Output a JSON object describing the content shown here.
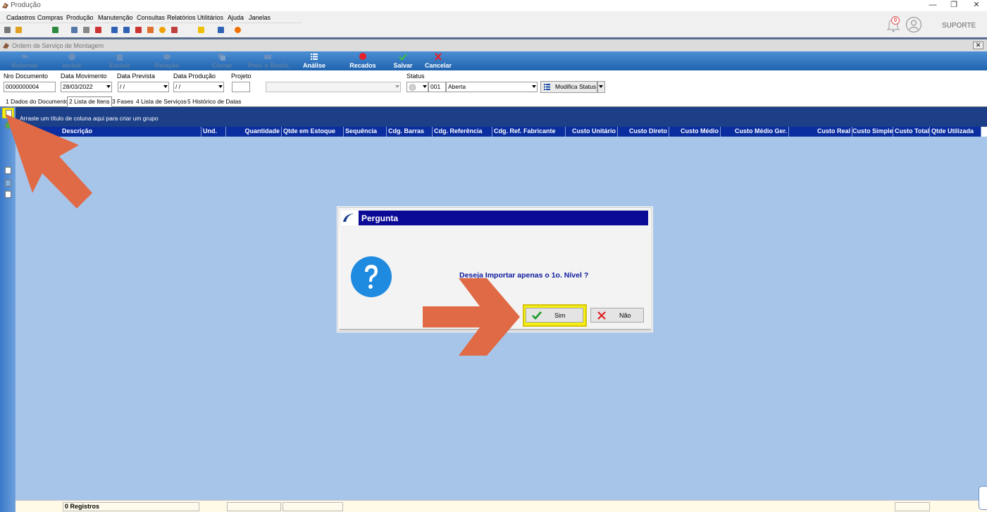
{
  "window": {
    "title": "Produção",
    "controls": {
      "minimize": "—",
      "maximize": "❐",
      "close": "✕"
    }
  },
  "menu": [
    "Cadastros",
    "Compras",
    "Produção",
    "Manutenção",
    "Consultas",
    "Relatórios",
    "Utilitários",
    "Ajuda",
    "Janelas"
  ],
  "user": {
    "name": "SUPORTE",
    "notification_count": "0"
  },
  "form": {
    "title": "Ordem de Serviço de Montagem",
    "close_label": "✕",
    "ribbon": [
      {
        "label": "Retornar",
        "enabled": false
      },
      {
        "label": "Incluir",
        "enabled": false
      },
      {
        "label": "Excluir",
        "enabled": false
      },
      {
        "label": "Relação",
        "enabled": false
      },
      {
        "label": "Clonar",
        "enabled": false
      },
      {
        "label": "Prev. e Realiz.",
        "enabled": false
      },
      {
        "label": "Análise",
        "enabled": true
      },
      {
        "label": "Recados",
        "enabled": true
      },
      {
        "label": "Salvar",
        "enabled": true
      },
      {
        "label": "Cancelar",
        "enabled": true
      }
    ],
    "fields": {
      "nro_documento": {
        "label": "Nro Documento",
        "value": "0000000004"
      },
      "data_movimento": {
        "label": "Data Movimento",
        "value": "28/03/2022"
      },
      "data_prevista": {
        "label": "Data Prevista",
        "value": " / /"
      },
      "data_producao": {
        "label": "Data Produção",
        "value": " / /"
      },
      "projeto": {
        "label": "Projeto",
        "value": ""
      },
      "projeto_desc": {
        "value": ""
      },
      "status": {
        "label": "Status",
        "code": "001",
        "value": "Aberta"
      },
      "modifica_status": "Modifica Status"
    },
    "tabs": [
      "1 Dados do Documento",
      "2 Lista de Itens",
      "3 Fases",
      "4 Lista de Serviços",
      "5 Histórico de Datas"
    ],
    "active_tab": "2 Lista de Itens",
    "group_hint": "Arraste um título de coluna aqui para criar um grupo",
    "columns": [
      "Descrição",
      "Und.",
      "Quantidade",
      "Qtde em Estoque",
      "Sequência",
      "Cdg. Barras",
      "Cdg. Referência",
      "Cdg. Ref. Fabricante",
      "Custo Unitário",
      "Custo Direto",
      "Custo Médio",
      "Custo Médio Ger.",
      "Custo Real",
      "Custo Simples",
      "Custo Total",
      "Qtde Utilizada"
    ],
    "status_bar": {
      "records": "0 Registros"
    }
  },
  "dialog": {
    "title": "Pergunta",
    "message": "Deseja Importar apenas o 1o. Nível ?",
    "yes_label": "Sim",
    "no_label": "Não"
  },
  "colors": {
    "ribbon": "#2a6fbd",
    "grid_header": "#0a2ea0",
    "grid_body": "#a7c5e9",
    "dialog_title": "#0b0a96",
    "highlight": "#f4ee12",
    "arrow": "#e06a45"
  }
}
